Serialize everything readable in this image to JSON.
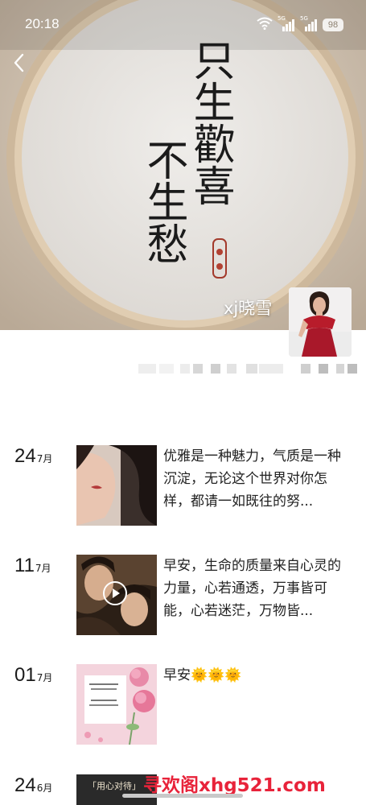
{
  "status_bar": {
    "time": "20:18",
    "signal1": "5G",
    "signal2": "5G",
    "battery": "98",
    "icons": [
      "wifi-icon",
      "signal-icon",
      "signal-icon",
      "battery-icon"
    ]
  },
  "header": {
    "back_icon": "chevron-left-icon",
    "cover_calligraphy": [
      "只生歡喜",
      "不生愁"
    ],
    "username": "xj晓雪"
  },
  "posts": [
    {
      "day": "24",
      "month": "7月",
      "text": "优雅是一种魅力，气质是一种沉淀，无论这个世界对你怎样，都请一如既往的努...",
      "media": "photo"
    },
    {
      "day": "11",
      "month": "7月",
      "text": "早安，生命的质量来自心灵的力量，心若通透，万事皆可能，心若迷茫，万物皆...",
      "media": "video"
    },
    {
      "day": "01",
      "month": "7月",
      "text": "早安🌞🌞🌞",
      "media": "photo"
    },
    {
      "day": "24",
      "month": "6月",
      "text": "",
      "media": "photo",
      "thumb_caption": "「用心对待」"
    }
  ],
  "watermark": "寻欢阁xhg521.com",
  "colors": {
    "watermark": "#e8233a",
    "text": "#222222"
  }
}
